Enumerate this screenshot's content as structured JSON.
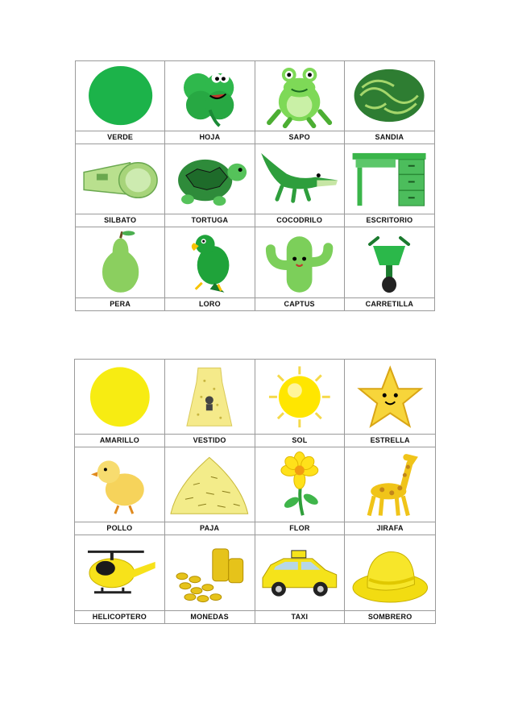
{
  "colors": {
    "green": "#1cb34a",
    "yellow": "#f7ec12"
  },
  "green_cards": [
    {
      "label": "VERDE",
      "icon": "green-circle-icon"
    },
    {
      "label": "HOJA",
      "icon": "clover-leaf-icon"
    },
    {
      "label": "SAPO",
      "icon": "frog-icon"
    },
    {
      "label": "SANDIA",
      "icon": "watermelon-icon"
    },
    {
      "label": "SILBATO",
      "icon": "whistle-icon"
    },
    {
      "label": "TORTUGA",
      "icon": "turtle-icon"
    },
    {
      "label": "COCODRILO",
      "icon": "crocodile-icon"
    },
    {
      "label": "ESCRITORIO",
      "icon": "desk-icon"
    },
    {
      "label": "PERA",
      "icon": "pear-icon"
    },
    {
      "label": "LORO",
      "icon": "parrot-icon"
    },
    {
      "label": "CAPTUS",
      "icon": "cactus-icon"
    },
    {
      "label": "CARRETILLA",
      "icon": "wheelbarrow-icon"
    }
  ],
  "yellow_cards": [
    {
      "label": "AMARILLO",
      "icon": "yellow-circle-icon"
    },
    {
      "label": "VESTIDO",
      "icon": "dress-icon"
    },
    {
      "label": "SOL",
      "icon": "sun-icon"
    },
    {
      "label": "ESTRELLA",
      "icon": "star-icon"
    },
    {
      "label": "POLLO",
      "icon": "chick-icon"
    },
    {
      "label": "PAJA",
      "icon": "straw-pile-icon"
    },
    {
      "label": "FLOR",
      "icon": "flower-icon"
    },
    {
      "label": "JIRAFA",
      "icon": "giraffe-icon"
    },
    {
      "label": "HELICOPTERO",
      "icon": "helicopter-icon"
    },
    {
      "label": "MONEDAS",
      "icon": "coins-icon"
    },
    {
      "label": "TAXI",
      "icon": "taxi-icon"
    },
    {
      "label": "SOMBRERO",
      "icon": "hat-icon"
    }
  ]
}
